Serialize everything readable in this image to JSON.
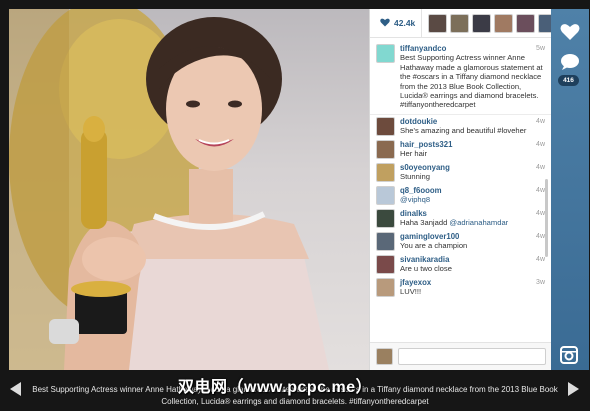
{
  "likes": {
    "count": "42.4k",
    "icon": "heart-icon",
    "liker_colors": [
      "#5a4a44",
      "#7c6f5a",
      "#3b3b46",
      "#a07a62",
      "#6b4e5c",
      "#4a5f78"
    ]
  },
  "caption_post": {
    "username": "tiffanyandco",
    "age": "5w",
    "avatar_color": "#81d8d0",
    "text": "Best Supporting Actress winner Anne Hathaway made a glamorous statement at the #oscars in a Tiffany diamond necklace from the 2013 Blue Book Collection, Lucida® earrings and diamond bracelets. #tiffanyontheredcarpet"
  },
  "comments": [
    {
      "username": "dotdoukie",
      "age": "4w",
      "text": "She's amazing and beautiful #loveher",
      "mention": "",
      "avatar_color": "#6d4b3d"
    },
    {
      "username": "hair_posts321",
      "age": "4w",
      "text": "Her hair ",
      "mention": "",
      "avatar_color": "#8a6a50"
    },
    {
      "username": "s0oyeonyang",
      "age": "4w",
      "text": "Stunning",
      "mention": "",
      "avatar_color": "#c0a060"
    },
    {
      "username": "q8_f6ooom",
      "age": "4w",
      "text": "",
      "mention": "@viphq8",
      "avatar_color": "#b9c8d8"
    },
    {
      "username": "dinalks",
      "age": "4w",
      "text": "Haha 3anjadd ",
      "mention": "@adrianahamdar",
      "avatar_color": "#3b4a3e"
    },
    {
      "username": "gaminglover100",
      "age": "4w",
      "text": "You are a champion",
      "mention": "",
      "avatar_color": "#5a6878"
    },
    {
      "username": "sivanikaradia",
      "age": "4w",
      "text": "Are u two close",
      "mention": "",
      "avatar_color": "#7a4a4a"
    },
    {
      "username": "jfayexox",
      "age": "3w",
      "text": "LUV!!!",
      "mention": "",
      "avatar_color": "#b89a7c"
    }
  ],
  "compose": {
    "placeholder": "",
    "value": "",
    "avatar_color": "#9a8060"
  },
  "rail": {
    "like_icon": "heart-icon",
    "comment_icon": "speech-bubble-icon",
    "comment_count": "416",
    "instagram_icon": "camera-icon"
  },
  "bottom_caption": "Best Supporting Actress winner Anne Hathaway made a glamorous statement at the #oscars in a Tiffany diamond necklace from the 2013 Blue Book Collection, Lucida® earrings and diamond bracelets. #tiffanyontheredcarpet",
  "watermark": "双电网（www.pcpc.me）",
  "colors": {
    "accent": "#2e5e86",
    "rail": "#3f7099",
    "background": "#161616"
  }
}
